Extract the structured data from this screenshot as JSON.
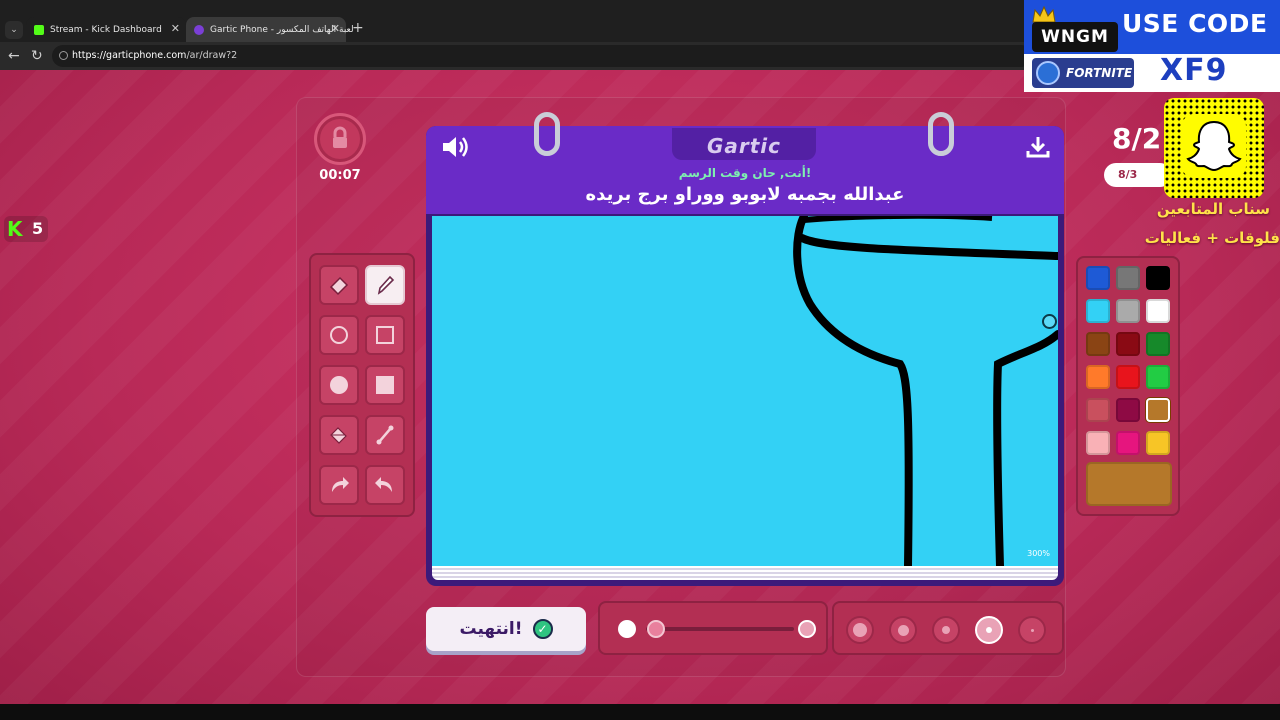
{
  "browser": {
    "tabs": [
      {
        "title": "Stream - Kick Dashboard",
        "favicon": "kick-icon",
        "color": "#53fc18",
        "active": false
      },
      {
        "title": "Gartic Phone - لعبة الهاتف المكسور",
        "favicon": "gartic-phone-icon",
        "color": "#7b3fd6",
        "active": true
      }
    ],
    "url_host": "https://garticphone.com",
    "url_path": "/ar/draw?2"
  },
  "game": {
    "logo": "Gartic",
    "timer": "00:07",
    "prompt_header": "أنت, حان وقت الرسم!",
    "prompt_text": "عبدالله بجمبه لابوبو ووراو برج بريده",
    "zoom": "300%",
    "round": "8/2",
    "progress": "8/3",
    "done_label": "انتهيت!",
    "tools": [
      "eraser",
      "pencil",
      "circle-outline",
      "square-outline",
      "circle-filled",
      "square-filled",
      "fill-bucket",
      "line",
      "undo",
      "redo"
    ],
    "active_tool": "pencil",
    "palette": [
      "#1e5ad6",
      "#777777",
      "#000000",
      "#33d1f5",
      "#aaaaaa",
      "#ffffff",
      "#8a4414",
      "#8a0a14",
      "#16892a",
      "#ff7a2a",
      "#e8141c",
      "#22cc44",
      "#c9505e",
      "#8e0a44",
      "#b5782a",
      "#f9b1b6",
      "#e6157e",
      "#f7c526"
    ],
    "selected_color": "#b5782a",
    "opacity_level": 0.2,
    "brush_sizes_selected": 4
  },
  "overlay": {
    "kick_viewers": "5",
    "wngm": "WNGM",
    "use_code": "USE CODE",
    "fortnite": "FORTNITE",
    "code": "XF9",
    "snap_line1": "سناب المتابعين",
    "snap_line2": "فلوقات + فعاليات"
  }
}
